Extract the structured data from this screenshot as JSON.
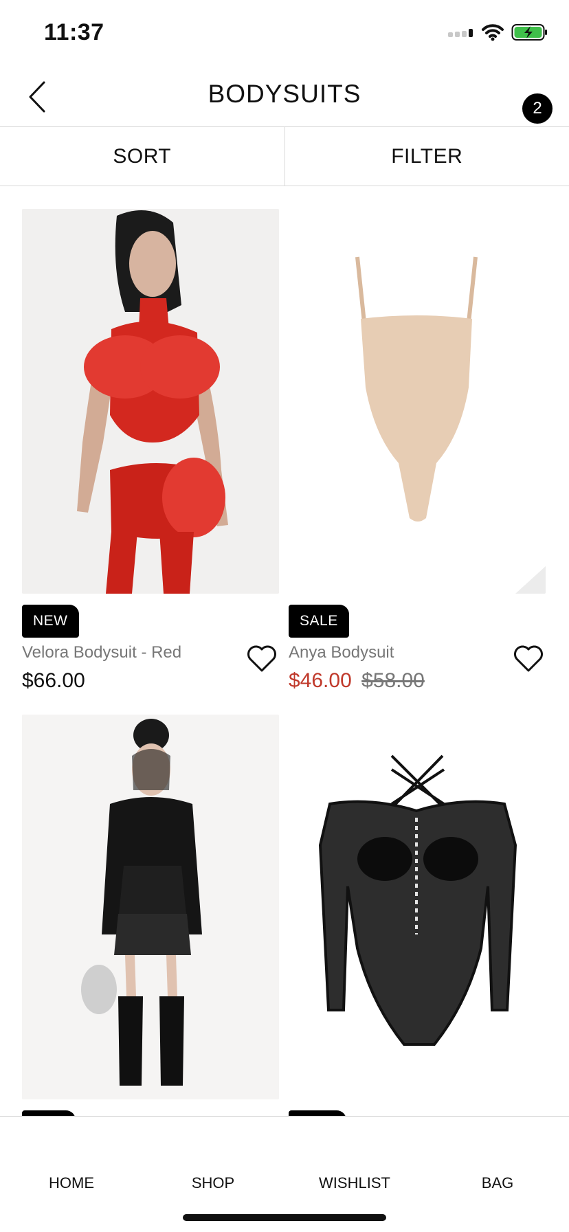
{
  "status_bar": {
    "time": "11:37"
  },
  "header": {
    "title": "BODYSUITS",
    "bag_count": "2"
  },
  "toolbar": {
    "sort_label": "SORT",
    "filter_label": "FILTER"
  },
  "products": [
    {
      "tag": "NEW",
      "name": "Velora Bodysuit - Red",
      "price": "$66.00"
    },
    {
      "tag": "SALE",
      "name": "Anya Bodysuit",
      "price": "$46.00",
      "old_price": "$58.00"
    },
    {
      "image": "black-bodysuit-model-photo"
    },
    {
      "image": "black-lace-bodysuit-photo"
    }
  ],
  "nav": {
    "home": "HOME",
    "shop": "SHOP",
    "wishlist": "WISHLIST",
    "bag": "BAG"
  },
  "colors": {
    "sale_red": "#c0392b",
    "badge_black": "#000000",
    "battery_green": "#3fbf4a"
  }
}
